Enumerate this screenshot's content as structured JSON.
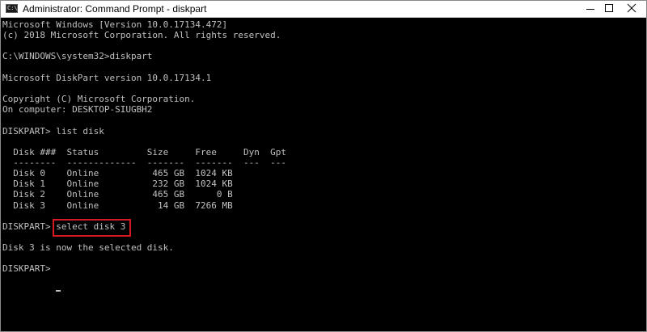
{
  "window": {
    "title": "Administrator: Command Prompt - diskpart",
    "icon_name": "cmd-icon",
    "icon_glyph": "C:\\",
    "controls": [
      "minimize-icon",
      "maximize-icon",
      "close-icon"
    ]
  },
  "console": {
    "lines": [
      "Microsoft Windows [Version 10.0.17134.472]",
      "(c) 2018 Microsoft Corporation. All rights reserved.",
      "",
      "C:\\WINDOWS\\system32>diskpart",
      "",
      "Microsoft DiskPart version 10.0.17134.1",
      "",
      "Copyright (C) Microsoft Corporation.",
      "On computer: DESKTOP-SIUGBH2",
      "",
      "DISKPART> list disk",
      "",
      "  Disk ###  Status         Size     Free     Dyn  Gpt",
      "  --------  -------------  -------  -------  ---  ---",
      "  Disk 0    Online          465 GB  1024 KB",
      "  Disk 1    Online          232 GB  1024 KB",
      "  Disk 2    Online          465 GB      0 B",
      "  Disk 3    Online           14 GB  7266 MB",
      "",
      "DISKPART> select disk 3",
      "",
      "Disk 3 is now the selected disk.",
      "",
      "DISKPART> "
    ]
  },
  "colors": {
    "console_bg": "#000000",
    "console_fg": "#c0c0c0",
    "highlight": "#d71921"
  }
}
